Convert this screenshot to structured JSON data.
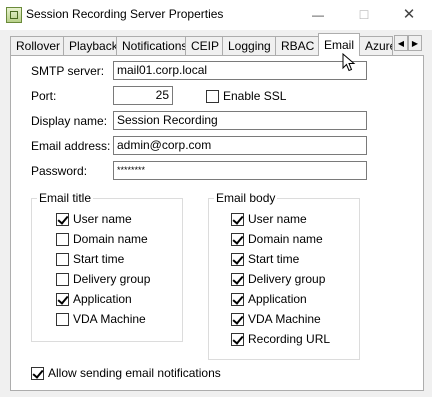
{
  "window": {
    "title": "Session Recording Server Properties",
    "minimize_glyph": "—",
    "maximize_glyph": "☐",
    "close_glyph": "✕"
  },
  "tabs": [
    {
      "label": "Rollover"
    },
    {
      "label": "Playback"
    },
    {
      "label": "Notifications"
    },
    {
      "label": "CEIP"
    },
    {
      "label": "Logging"
    },
    {
      "label": "RBAC"
    },
    {
      "label": "Email",
      "active": true
    },
    {
      "label": "Azure"
    }
  ],
  "tab_scroll": {
    "left_glyph": "◀",
    "right_glyph": "▶"
  },
  "form": {
    "smtp_server": {
      "label": "SMTP server:",
      "value": "mail01.corp.local"
    },
    "port": {
      "label": "Port:",
      "value": "25"
    },
    "enable_ssl": {
      "label": "Enable SSL",
      "checked": false
    },
    "display_name": {
      "label": "Display name:",
      "value": "Session Recording"
    },
    "email_address": {
      "label": "Email address:",
      "value": "admin@corp.com"
    },
    "password": {
      "label": "Password:",
      "value": "********"
    }
  },
  "email_title": {
    "legend": "Email title",
    "items": [
      {
        "label": "User name",
        "checked": true
      },
      {
        "label": "Domain name",
        "checked": false
      },
      {
        "label": "Start time",
        "checked": false
      },
      {
        "label": "Delivery group",
        "checked": false
      },
      {
        "label": "Application",
        "checked": true
      },
      {
        "label": "VDA Machine",
        "checked": false
      }
    ]
  },
  "email_body": {
    "legend": "Email body",
    "items": [
      {
        "label": "User name",
        "checked": true
      },
      {
        "label": "Domain name",
        "checked": true
      },
      {
        "label": "Start time",
        "checked": true
      },
      {
        "label": "Delivery group",
        "checked": true
      },
      {
        "label": "Application",
        "checked": true
      },
      {
        "label": "VDA Machine",
        "checked": true
      },
      {
        "label": "Recording URL",
        "checked": true
      }
    ]
  },
  "allow_notifications": {
    "label": "Allow sending email notifications",
    "checked": true
  }
}
